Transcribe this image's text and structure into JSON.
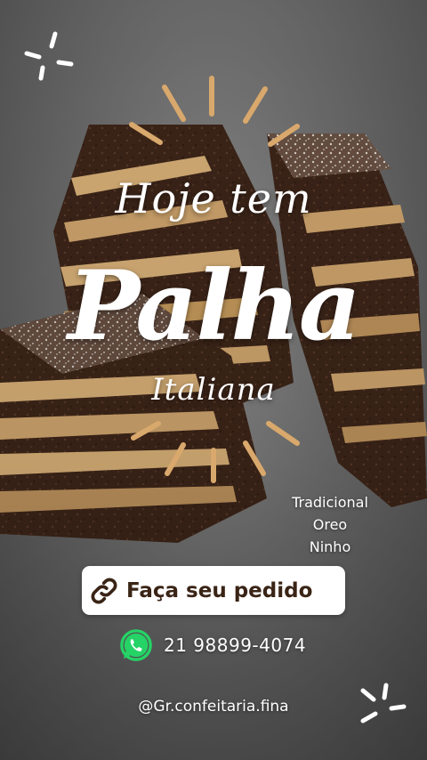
{
  "title": {
    "line1": "Hoje tem",
    "line2": "Palha",
    "line3": "Italiana"
  },
  "flavors": [
    "Tradicional",
    "Oreo",
    "Ninho"
  ],
  "cta": {
    "label": "Faça seu pedido",
    "icon": "link-icon"
  },
  "contact": {
    "icon": "whatsapp-icon",
    "phone": "21 98899-4074"
  },
  "social": {
    "handle": "@Gr.confeitaria.fina"
  },
  "colors": {
    "accent_rays": "#d9a86c",
    "button_text": "#3a2416",
    "whatsapp_green": "#25d366"
  }
}
